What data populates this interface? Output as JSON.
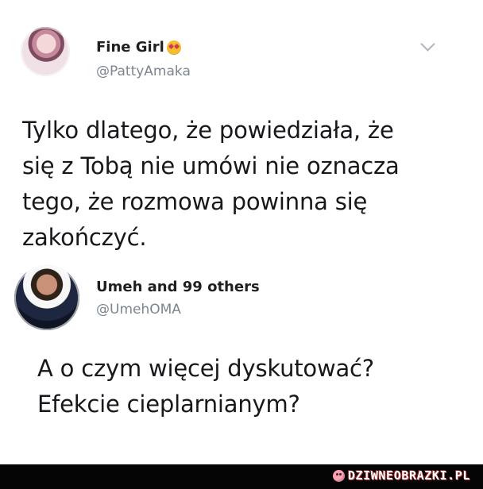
{
  "main_post": {
    "name": "Fine Girl",
    "handle": "@PattyAmaka",
    "text": "Tylko dlatego, że powiedziała, że\nsię z Tobą nie umówi nie oznacza\ntego, że rozmowa powinna się\nzakończyć."
  },
  "reply_post": {
    "name": "Umeh and 99 others",
    "handle": "@UmehOMA",
    "text": "A o czym więcej dyskutować?\nEfekcie cieplarnianym?"
  },
  "watermark": {
    "label": "DZIWNEOBRAZKI.PL"
  },
  "icons": {
    "main_emoji": "heart-eyes-emoji-icon",
    "chevron": "chevron-down-icon",
    "watermark": "watermark-face-icon"
  }
}
